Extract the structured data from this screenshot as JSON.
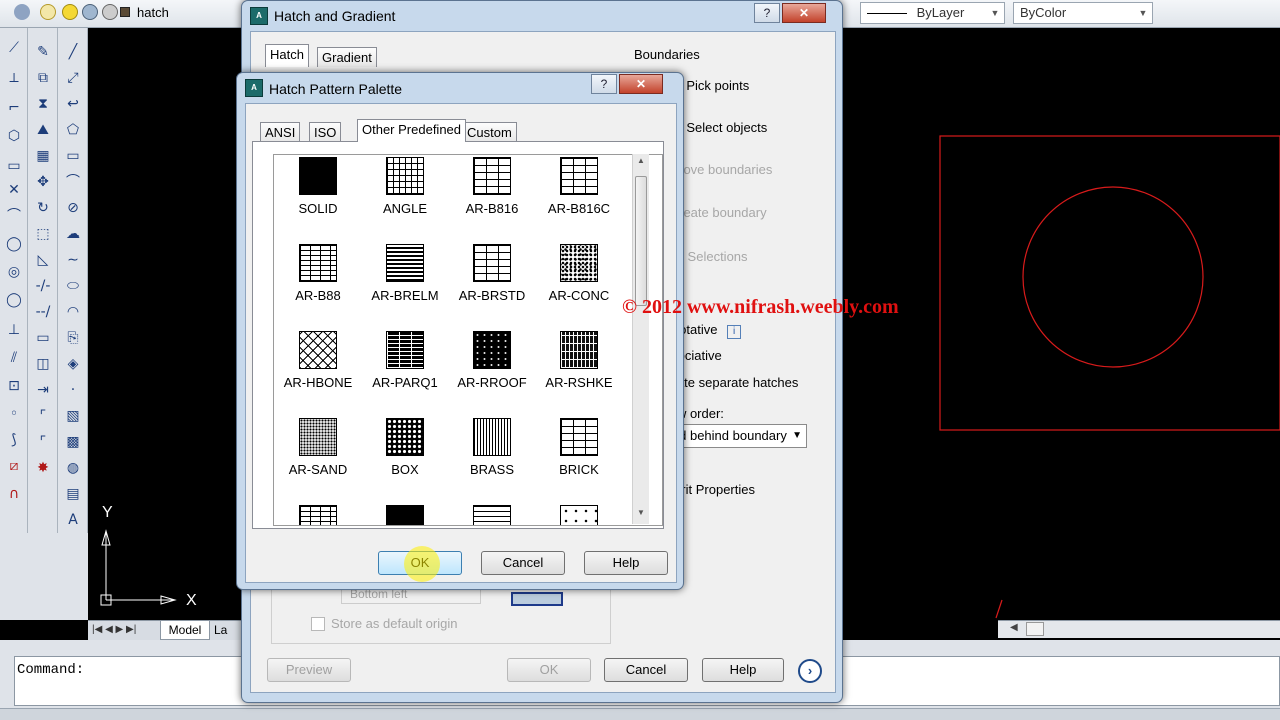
{
  "topbar": {
    "layer_name": "hatch",
    "linetype_combo": "ByLayer",
    "color_combo": "ByColor"
  },
  "hatch_dialog": {
    "title": "Hatch and Gradient",
    "tabs": [
      "Hatch",
      "Gradient"
    ],
    "boundaries_label": "Boundaries",
    "add_pick_points": "Add: Pick points",
    "add_select_objects": "Add: Select objects",
    "remove_boundaries": "Remove boundaries",
    "recreate_boundary": "Recreate boundary",
    "view_selections": "View Selections",
    "annotative": "Annotative",
    "associative": "Associative",
    "create_separate": "Create separate hatches",
    "draw_order_label": "Draw order:",
    "draw_order_value": "Send behind boundary",
    "inherit_properties": "Inherit Properties",
    "origin_position": "Bottom left",
    "store_default_origin": "Store as default origin",
    "preview_button": "Preview",
    "ok_button": "OK",
    "cancel_button": "Cancel",
    "help_button": "Help"
  },
  "palette": {
    "title": "Hatch Pattern Palette",
    "help_caption": "?",
    "close_caption": "X",
    "tabs": [
      "ANSI",
      "ISO",
      "Other Predefined",
      "Custom"
    ],
    "active_tab": "Other Predefined",
    "patterns": [
      {
        "name": "SOLID",
        "style": "solid"
      },
      {
        "name": "ANGLE",
        "style": "angle"
      },
      {
        "name": "AR-B816",
        "style": "brick"
      },
      {
        "name": "AR-B816C",
        "style": "brick"
      },
      {
        "name": "AR-B88",
        "style": "brickd"
      },
      {
        "name": "AR-BRELM",
        "style": "brelm"
      },
      {
        "name": "AR-BRSTD",
        "style": "brick"
      },
      {
        "name": "AR-CONC",
        "style": "conc"
      },
      {
        "name": "AR-HBONE",
        "style": "hbone"
      },
      {
        "name": "AR-PARQ1",
        "style": "parq"
      },
      {
        "name": "AR-RROOF",
        "style": "rroof"
      },
      {
        "name": "AR-RSHKE",
        "style": "rshke"
      },
      {
        "name": "AR-SAND",
        "style": "sand"
      },
      {
        "name": "BOX",
        "style": "box"
      },
      {
        "name": "BRASS",
        "style": "brass"
      },
      {
        "name": "BRICK",
        "style": "brick"
      },
      {
        "name": "",
        "style": "brickd"
      },
      {
        "name": "",
        "style": "solid"
      },
      {
        "name": "",
        "style": "wave"
      },
      {
        "name": "",
        "style": "dots"
      }
    ],
    "ok_button": "OK",
    "cancel_button": "Cancel",
    "help_button": "Help"
  },
  "canvas": {
    "watermark": "© 2012 www.nifrash.weebly.com",
    "ucs_x": "X",
    "ucs_y": "Y",
    "model_tab": "Model",
    "layout_tab": "La",
    "colors": {
      "drawing_red": "#d81b1b",
      "watermark": "#e01010"
    }
  },
  "command": {
    "prompt": "Command:"
  }
}
